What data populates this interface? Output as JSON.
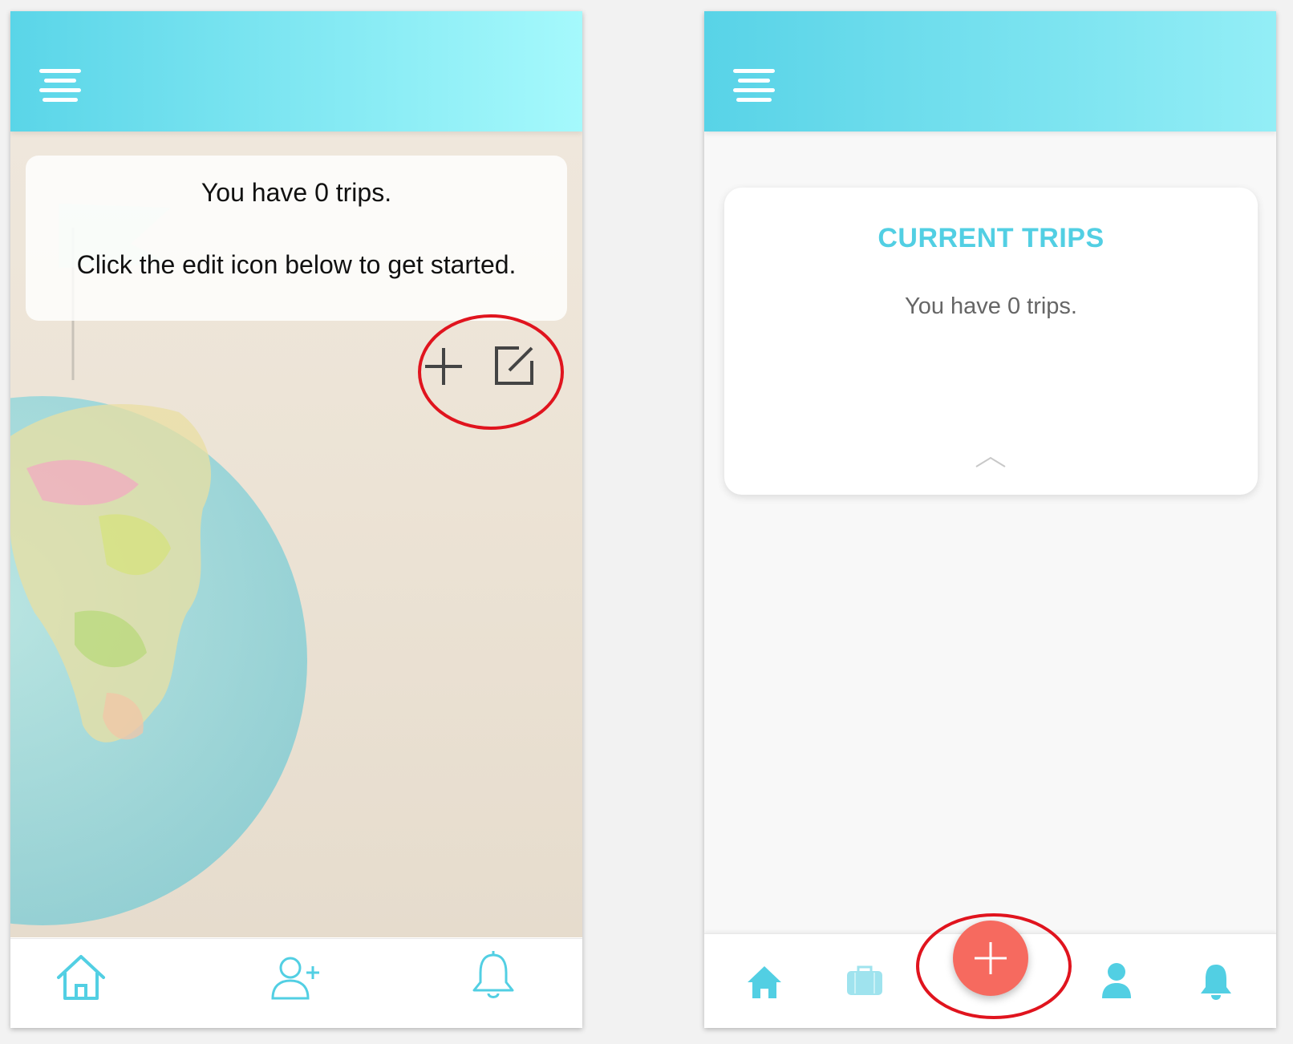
{
  "screen_a": {
    "intro": {
      "line1": "You have 0 trips.",
      "line2": "Click the edit icon below to get started."
    },
    "actions": [
      "plus-icon",
      "edit-icon"
    ],
    "nav": [
      "home-icon",
      "add-user-icon",
      "bell-icon"
    ]
  },
  "screen_b": {
    "card": {
      "title": "CURRENT TRIPS",
      "text": "You have 0 trips."
    },
    "nav": [
      "home-icon",
      "suitcase-icon",
      "plus-icon",
      "user-icon",
      "bell-icon"
    ]
  },
  "colors": {
    "accent": "#52cfe3",
    "header_start": "#5ad5e8",
    "header_end": "#a5f9fc",
    "fab": "#f66a5f",
    "annotation": "#e0141e"
  }
}
